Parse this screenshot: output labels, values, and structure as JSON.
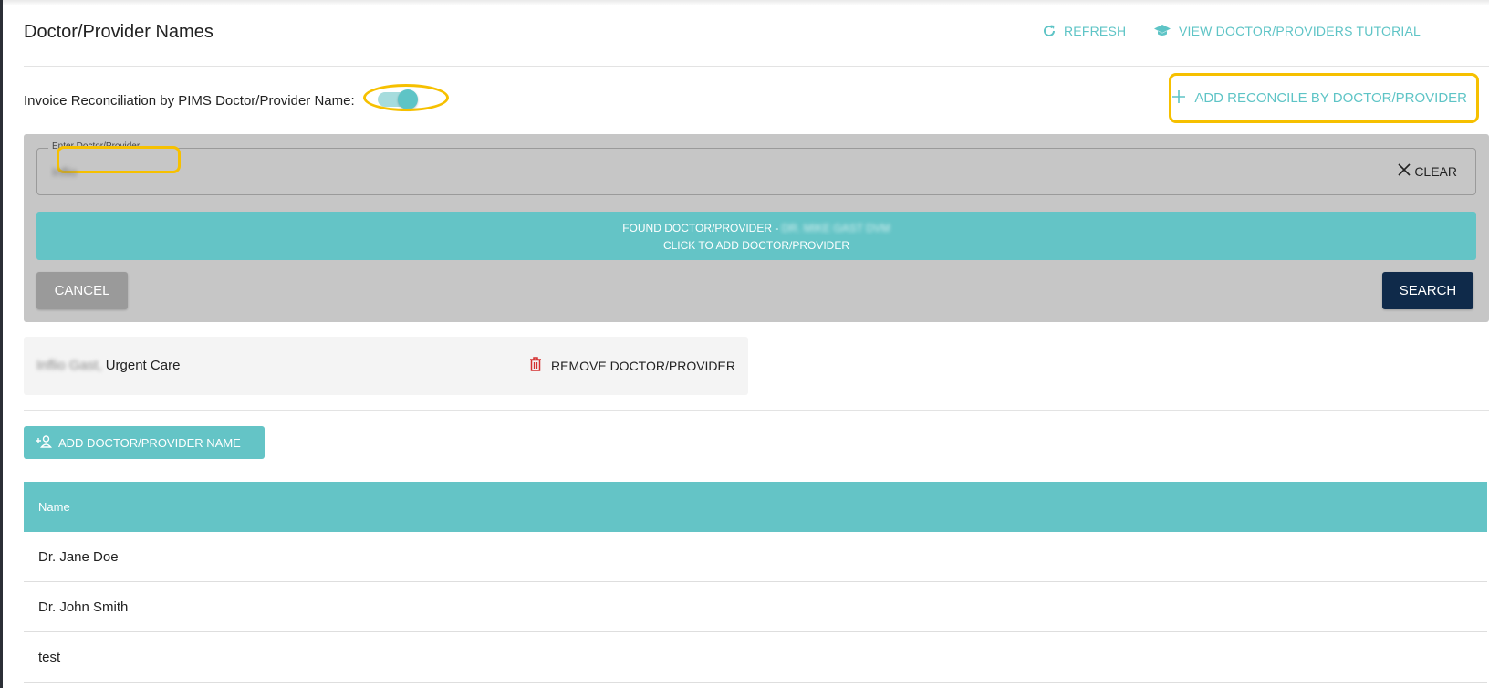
{
  "header": {
    "title": "Doctor/Provider Names",
    "refresh_label": "REFRESH",
    "tutorial_label": "VIEW DOCTOR/PROVIDERS TUTORIAL"
  },
  "reconciliation": {
    "toggle_label": "Invoice Reconciliation by PIMS Doctor/Provider Name:",
    "toggle_on": true,
    "add_reconcile_label": "ADD RECONCILE BY DOCTOR/PROVIDER"
  },
  "search_panel": {
    "field_label": "Enter Doctor/Provider",
    "field_value": "Inflio",
    "clear_label": "CLEAR",
    "found_line1": "FOUND DOCTOR/PROVIDER - ",
    "found_name": "DR. MIKE GAST DVM",
    "found_line2": "CLICK TO ADD DOCTOR/PROVIDER",
    "cancel_label": "CANCEL",
    "search_label": "SEARCH"
  },
  "selected_provider": {
    "name_blurred": "Inflio Gast,",
    "name_suffix": "Urgent Care",
    "remove_label": "REMOVE DOCTOR/PROVIDER"
  },
  "add_name_label": "ADD DOCTOR/PROVIDER NAME",
  "table": {
    "header": "Name",
    "rows": [
      "Dr. Jane Doe",
      "Dr. John Smith",
      "test"
    ]
  },
  "colors": {
    "accent": "#5ec4c6",
    "highlight": "#f6c000",
    "primary_dark": "#0f2a4a",
    "danger": "#d32f2f"
  },
  "icons": {
    "refresh": "refresh-icon",
    "tutorial": "graduation-cap-icon",
    "add": "plus-icon",
    "clear": "close-icon",
    "remove": "trash-icon",
    "add_person": "add-person-icon"
  }
}
